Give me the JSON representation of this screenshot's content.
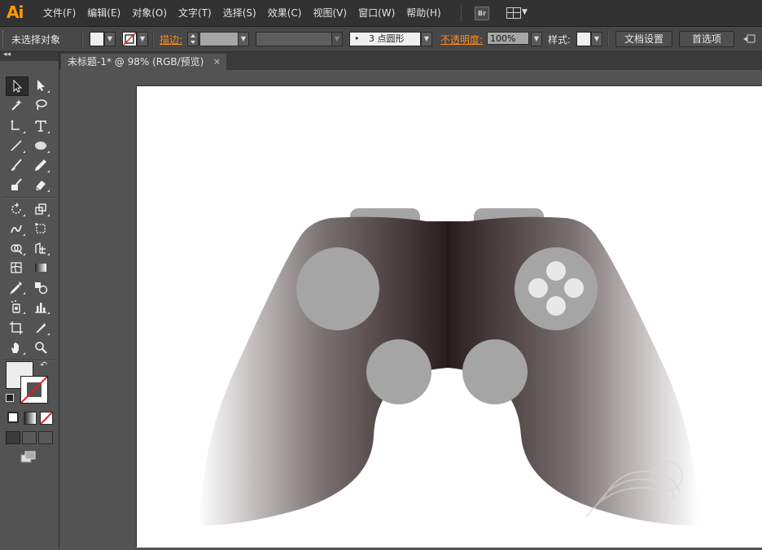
{
  "app": {
    "logo": "Ai"
  },
  "menu": [
    "文件(F)",
    "编辑(E)",
    "对象(O)",
    "文字(T)",
    "选择(S)",
    "效果(C)",
    "视图(V)",
    "窗口(W)",
    "帮助(H)"
  ],
  "menubar_icons": {
    "bridge_label": "Br",
    "workspace": "workspace-switcher-icon"
  },
  "control": {
    "selection_status": "未选择对象",
    "stroke_label": "描边:",
    "brush_label": "3 点圆形",
    "brush_dot": "•",
    "opacity_label": "不透明度:",
    "opacity_value": "100%",
    "style_label": "样式:",
    "doc_setup_button": "文档设置",
    "preferences_button": "首选项"
  },
  "document": {
    "tab_title": "未标题-1* @ 98% (RGB/预览)",
    "close": "×"
  },
  "toolbox": {
    "collapse": "◂◂"
  },
  "colors": {
    "accent_orange": "#ff9a00",
    "label_orange": "#ff8c1a",
    "controller_dark": "#2a1e1e",
    "controller_mid": "#6b6262",
    "button_gray": "#a5a5a5",
    "dpad_white": "#e8e8e8"
  },
  "artwork": {
    "subject": "game-controller-icon"
  }
}
